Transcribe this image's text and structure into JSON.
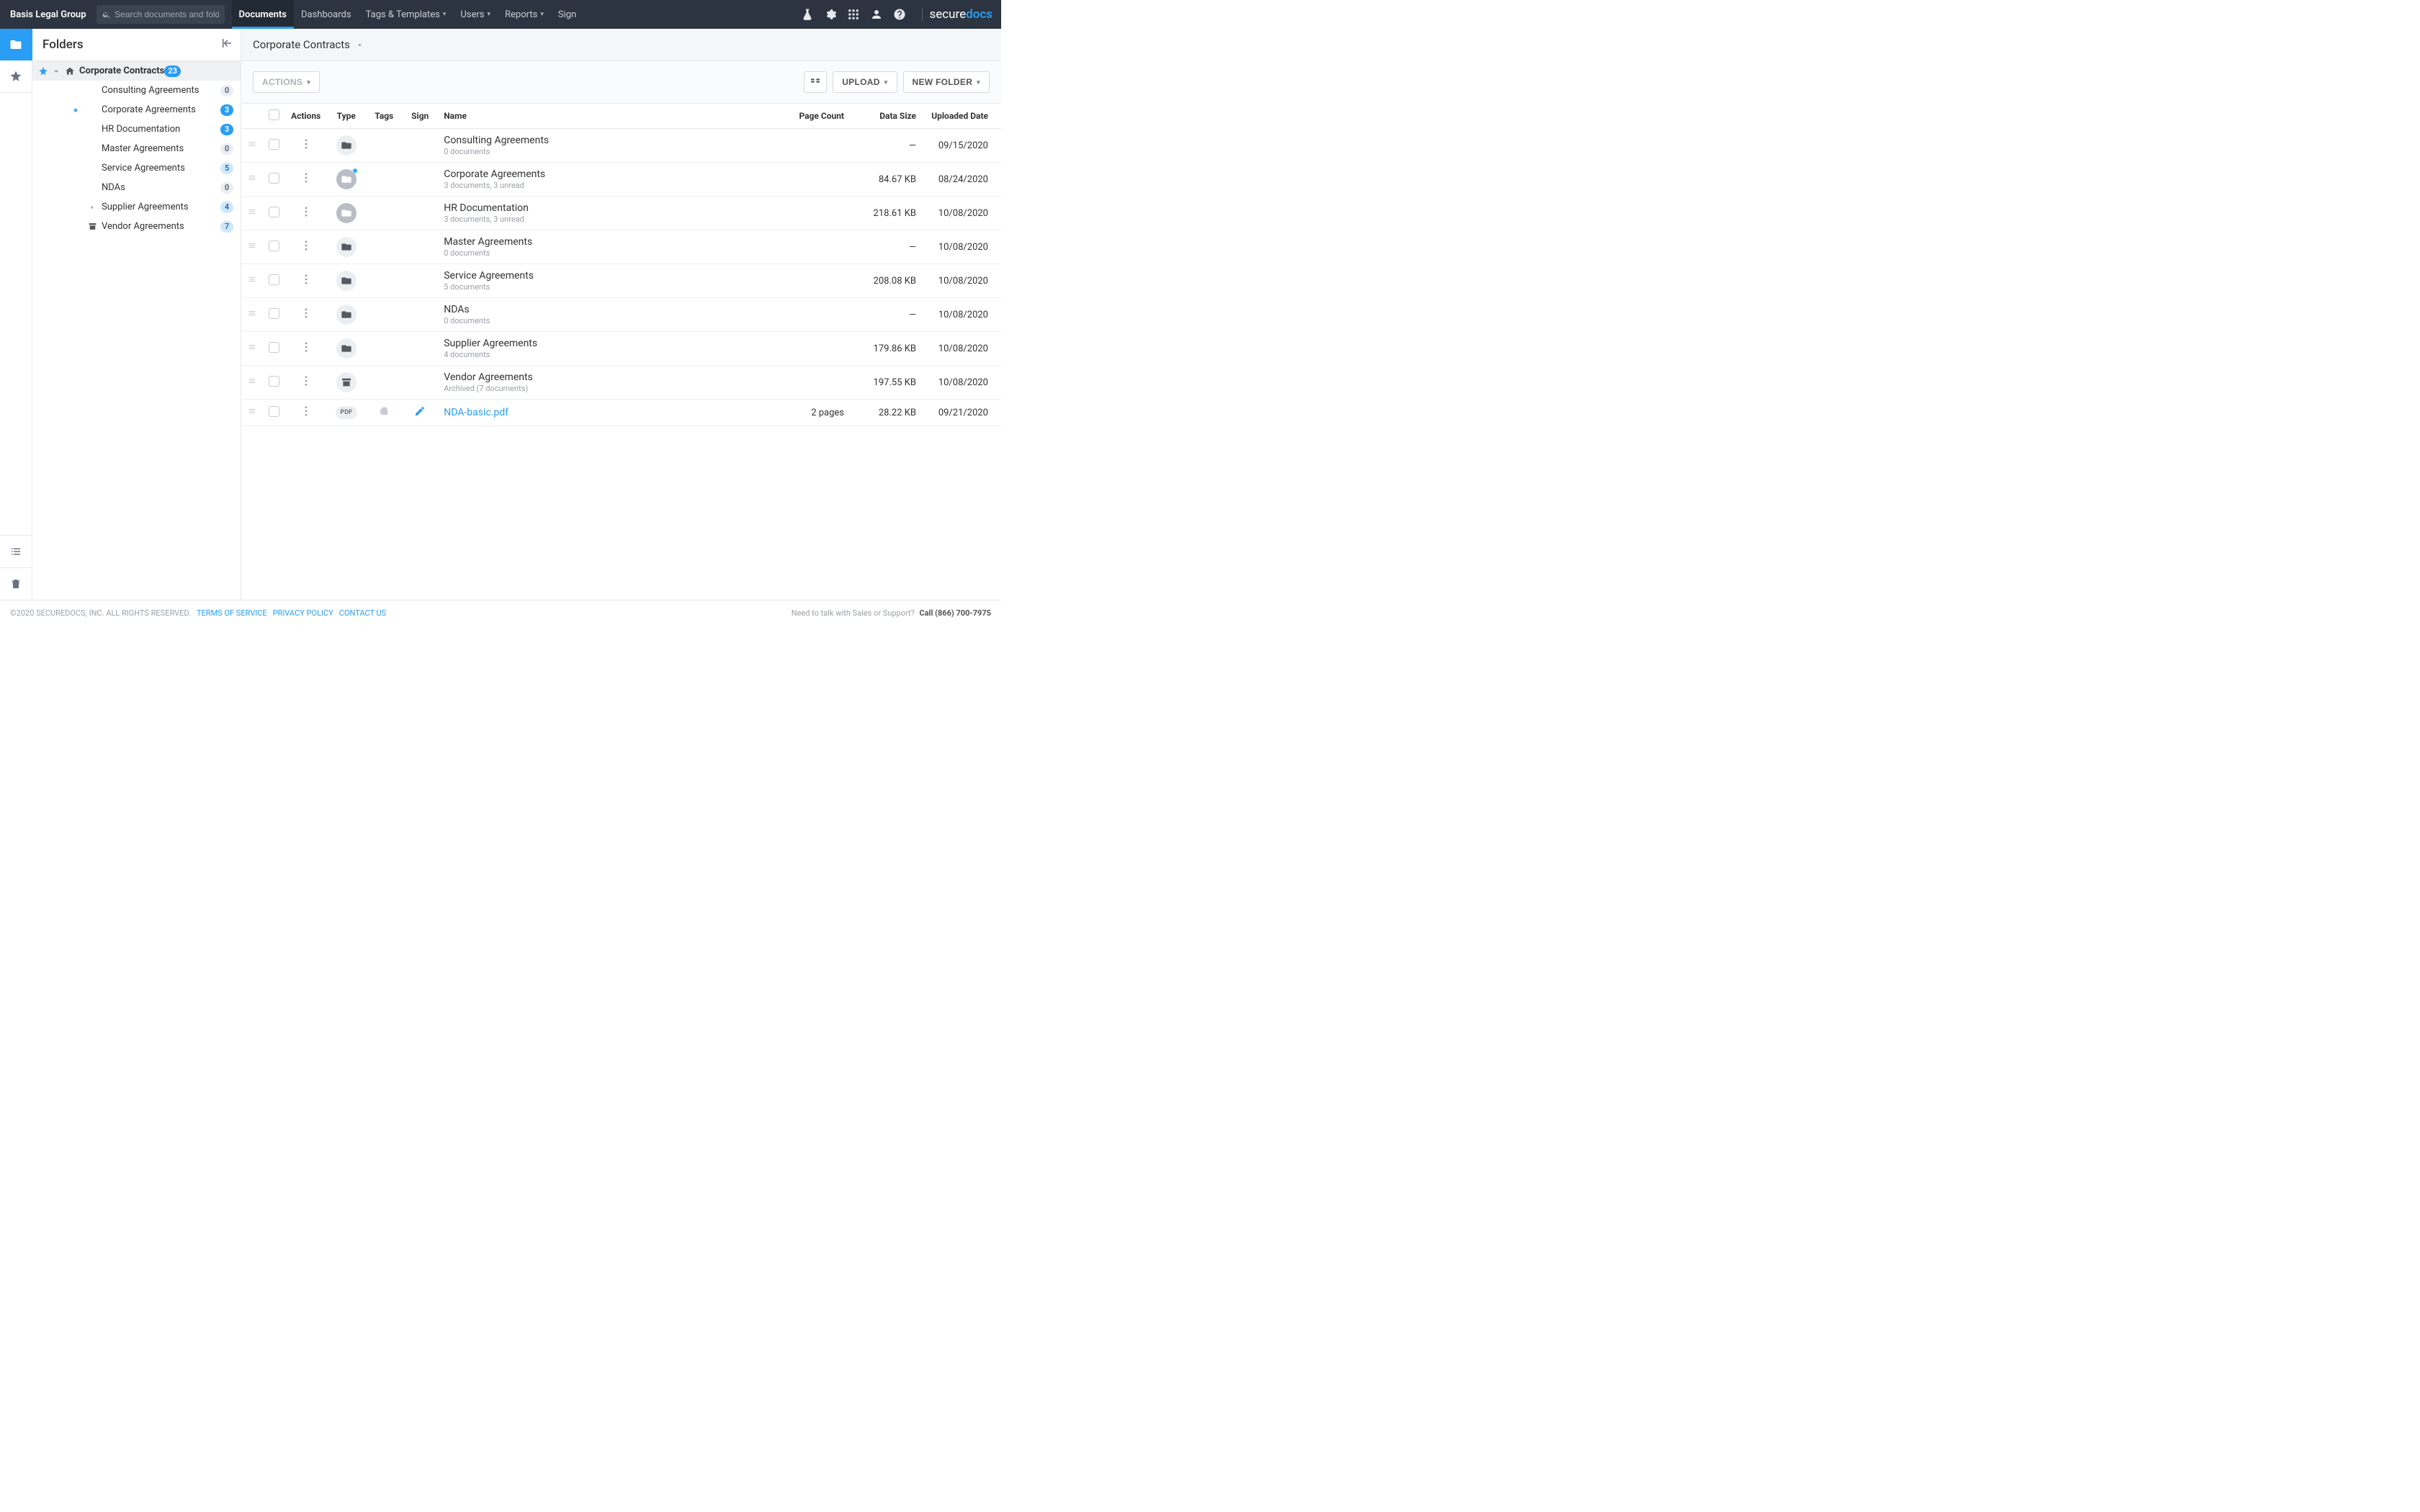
{
  "topnav": {
    "brand": "Basis Legal Group",
    "search_placeholder": "Search documents and folders",
    "tabs": [
      {
        "label": "Documents",
        "active": true
      },
      {
        "label": "Dashboards"
      },
      {
        "label": "Tags & Templates",
        "dropdown": true
      },
      {
        "label": "Users",
        "dropdown": true
      },
      {
        "label": "Reports",
        "dropdown": true
      },
      {
        "label": "Sign"
      }
    ],
    "logo_a": "secure",
    "logo_b": "docs"
  },
  "sidebar": {
    "title": "Folders",
    "root": {
      "label": "Corporate Contracts",
      "count": "23"
    },
    "items": [
      {
        "label": "Consulting Agreements",
        "count": "0",
        "badge": "plain"
      },
      {
        "label": "Corporate Agreements",
        "count": "3",
        "badge": "blue",
        "starred": true
      },
      {
        "label": "HR Documentation",
        "count": "3",
        "badge": "blue"
      },
      {
        "label": "Master Agreements",
        "count": "0",
        "badge": "plain"
      },
      {
        "label": "Service Agreements",
        "count": "5",
        "badge": "lblue"
      },
      {
        "label": "NDAs",
        "count": "0",
        "badge": "plain"
      },
      {
        "label": "Supplier Agreements",
        "count": "4",
        "badge": "lblue",
        "expandable": true
      },
      {
        "label": "Vendor Agreements",
        "count": "7",
        "badge": "lblue",
        "archive": true
      }
    ]
  },
  "breadcrumb": {
    "current": "Corporate Contracts"
  },
  "toolbar": {
    "actions": "ACTIONS",
    "upload": "UPLOAD",
    "newfolder": "NEW FOLDER"
  },
  "table": {
    "headers": {
      "actions": "Actions",
      "type": "Type",
      "tags": "Tags",
      "sign": "Sign",
      "name": "Name",
      "pages": "Page Count",
      "size": "Data Size",
      "date": "Uploaded Date"
    },
    "rows": [
      {
        "name": "Consulting Agreements",
        "sub": "0 documents",
        "type": "folder",
        "size": "—",
        "date": "09/15/2020"
      },
      {
        "name": "Corporate Agreements",
        "sub": "3 documents, 3 unread",
        "type": "folder-grey-star",
        "size": "84.67 KB",
        "date": "08/24/2020"
      },
      {
        "name": "HR Documentation",
        "sub": "3 documents, 3 unread",
        "type": "folder-grey",
        "size": "218.61 KB",
        "date": "10/08/2020"
      },
      {
        "name": "Master Agreements",
        "sub": "0 documents",
        "type": "folder",
        "size": "—",
        "date": "10/08/2020"
      },
      {
        "name": "Service Agreements",
        "sub": "5 documents",
        "type": "folder",
        "size": "208.08 KB",
        "date": "10/08/2020"
      },
      {
        "name": "NDAs",
        "sub": "0 documents",
        "type": "folder",
        "size": "—",
        "date": "10/08/2020"
      },
      {
        "name": "Supplier Agreements",
        "sub": "4 documents",
        "type": "folder",
        "size": "179.86 KB",
        "date": "10/08/2020"
      },
      {
        "name": "Vendor Agreements",
        "sub": "Archived (7 documents)",
        "type": "archive",
        "size": "197.55 KB",
        "date": "10/08/2020"
      },
      {
        "name": "NDA-basic.pdf",
        "type": "pdf",
        "link": true,
        "tags": true,
        "sign": true,
        "pages": "2 pages",
        "size": "28.22 KB",
        "date": "09/21/2020"
      }
    ]
  },
  "footer": {
    "copyright": "©2020 SECUREDOCS, INC. ALL RIGHTS RESERVED.",
    "terms": "TERMS OF SERVICE",
    "privacy": "PRIVACY POLICY",
    "contact": "CONTACT US",
    "help": "Need to talk with Sales or Support?",
    "phone": "Call (866) 700-7975"
  }
}
